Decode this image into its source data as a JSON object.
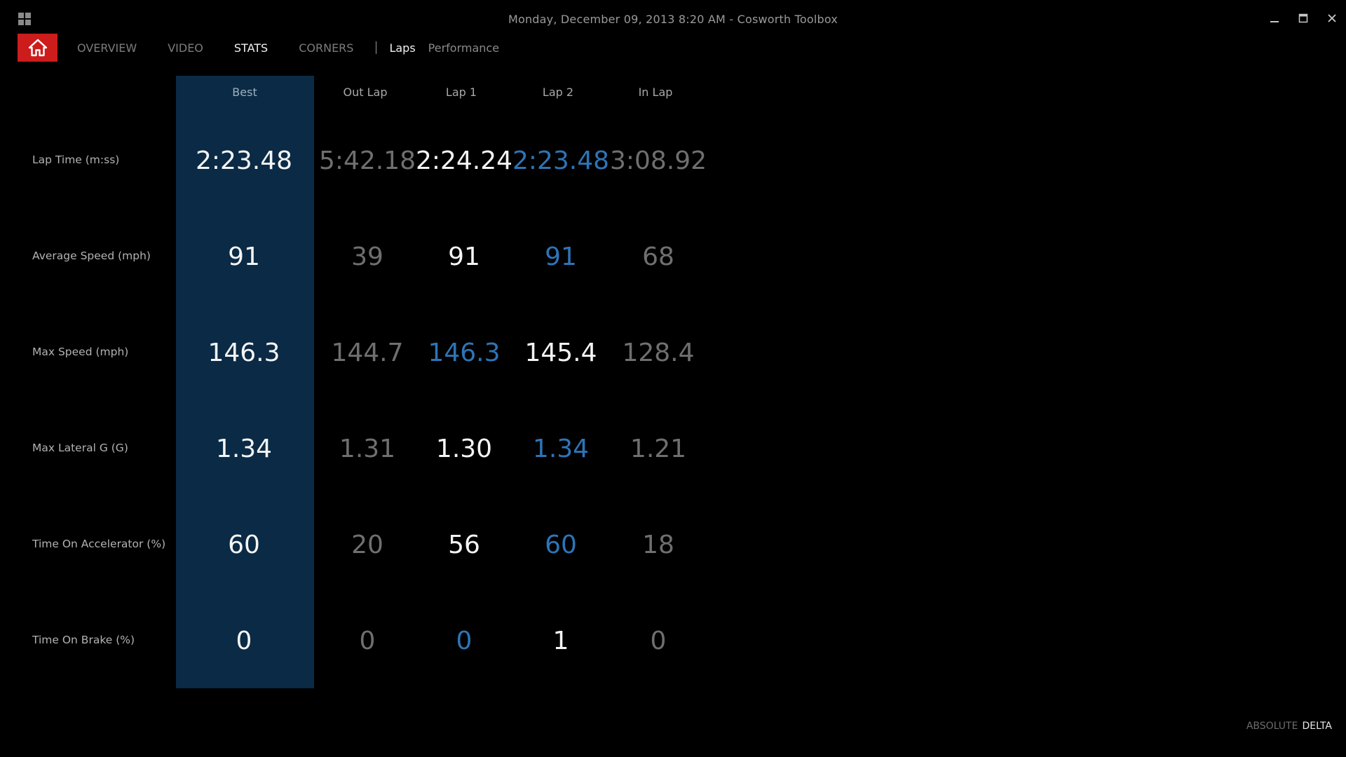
{
  "window": {
    "title": "Monday, December 09, 2013 8:20 AM - Cosworth Toolbox"
  },
  "colors": {
    "home_red": "#cc1c1c",
    "best_column_bg": "#0a2a45",
    "highlight_blue": "#2e74b5",
    "dim_gray": "#6f6f6f",
    "text_white": "#f4f4f4"
  },
  "icons": {
    "app_menu": "grid-icon",
    "home": "home-icon",
    "minimize": "minimize-icon",
    "maximize": "maximize-icon",
    "close": "close-icon"
  },
  "nav": {
    "tabs": [
      {
        "label": "OVERVIEW",
        "active": false
      },
      {
        "label": "VIDEO",
        "active": false
      },
      {
        "label": "STATS",
        "active": true
      },
      {
        "label": "CORNERS",
        "active": false
      }
    ],
    "subtabs": [
      {
        "label": "Laps",
        "active": true
      },
      {
        "label": "Performance",
        "active": false
      }
    ]
  },
  "stats": {
    "columns": [
      "Best",
      "Out Lap",
      "Lap 1",
      "Lap 2",
      "In Lap"
    ],
    "rows": [
      {
        "label": "Lap Time (m:ss)",
        "values": [
          "2:23.48",
          "5:42.18",
          "2:24.24",
          "2:23.48",
          "3:08.92"
        ],
        "styles": [
          "best",
          "dim",
          "norm",
          "blue",
          "dim"
        ]
      },
      {
        "label": "Average Speed (mph)",
        "values": [
          "91",
          "39",
          "91",
          "91",
          "68"
        ],
        "styles": [
          "best",
          "dim",
          "norm",
          "blue",
          "dim"
        ]
      },
      {
        "label": "Max Speed (mph)",
        "values": [
          "146.3",
          "144.7",
          "146.3",
          "145.4",
          "128.4"
        ],
        "styles": [
          "best",
          "dim",
          "blue",
          "norm",
          "dim"
        ]
      },
      {
        "label": "Max Lateral G (G)",
        "values": [
          "1.34",
          "1.31",
          "1.30",
          "1.34",
          "1.21"
        ],
        "styles": [
          "best",
          "dim",
          "norm",
          "blue",
          "dim"
        ]
      },
      {
        "label": "Time On Accelerator (%)",
        "values": [
          "60",
          "20",
          "56",
          "60",
          "18"
        ],
        "styles": [
          "best",
          "dim",
          "norm",
          "blue",
          "dim"
        ]
      },
      {
        "label": "Time On Brake (%)",
        "values": [
          "0",
          "0",
          "0",
          "1",
          "0"
        ],
        "styles": [
          "best",
          "dim",
          "blue",
          "norm",
          "dim"
        ]
      }
    ]
  },
  "footer": {
    "absolute_label": "ABSOLUTE",
    "delta_label": "DELTA",
    "active": "DELTA"
  }
}
